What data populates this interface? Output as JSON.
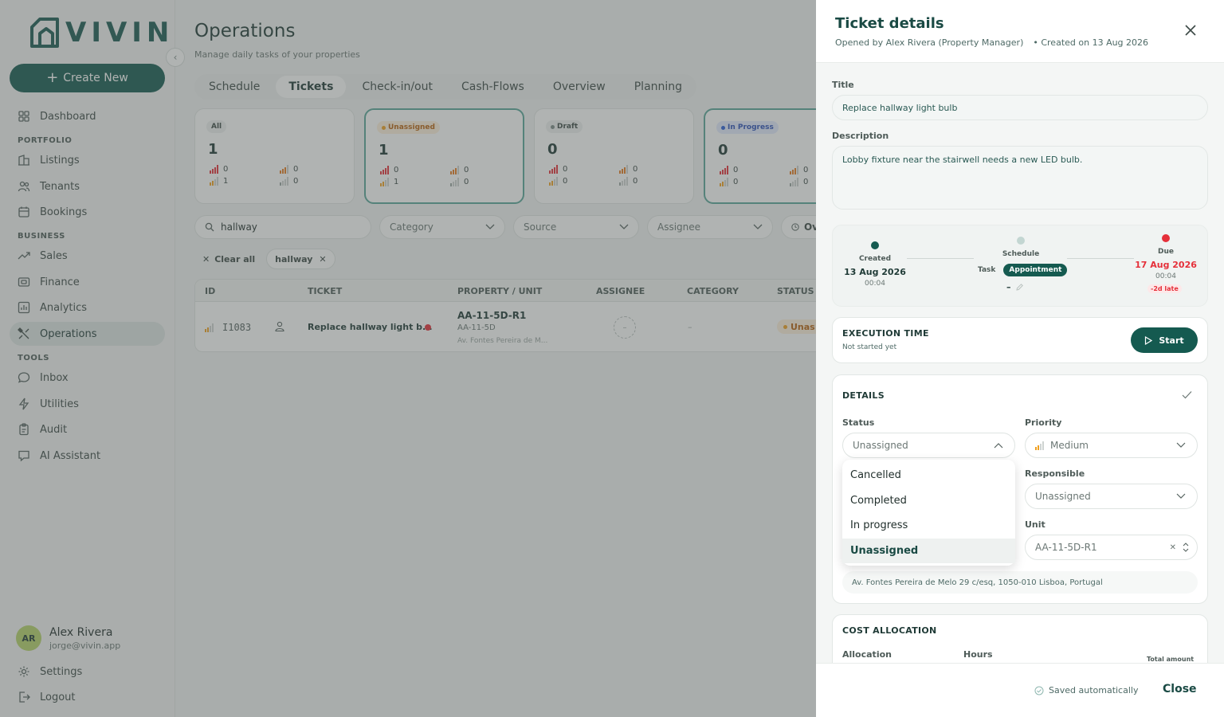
{
  "app": {
    "logo_text": "VIVIN",
    "create_new": "Create New"
  },
  "sidebar": {
    "dashboard": "Dashboard",
    "portfolio_section": "PORTFOLIO",
    "listings": "Listings",
    "tenants": "Tenants",
    "bookings": "Bookings",
    "business_section": "BUSINESS",
    "sales": "Sales",
    "finance": "Finance",
    "analytics": "Analytics",
    "operations": "Operations",
    "tools_section": "TOOLS",
    "inbox": "Inbox",
    "utilities": "Utilities",
    "audit": "Audit",
    "ai_assistant": "AI Assistant",
    "settings": "Settings",
    "logout": "Logout"
  },
  "user": {
    "initials": "AR",
    "name": "Alex Rivera",
    "email": "jorge@vivin.app"
  },
  "page": {
    "title": "Operations",
    "subtitle": "Manage daily tasks of your properties",
    "tabs": [
      "Schedule",
      "Tickets",
      "Check-in/out",
      "Cash-Flows",
      "Overview",
      "Planning"
    ],
    "active_tab": "Tickets"
  },
  "cards": [
    {
      "label": "All",
      "count": "1",
      "stats": [
        "0",
        "0",
        "1",
        "0"
      ]
    },
    {
      "label": "Unassigned",
      "count": "1",
      "stats": [
        "0",
        "0",
        "1",
        "0"
      ]
    },
    {
      "label": "Draft",
      "count": "0",
      "stats": [
        "0",
        "0",
        "0",
        "0"
      ]
    },
    {
      "label": "In Progress",
      "count": "0",
      "stats": [
        "0",
        "0",
        "0",
        "0"
      ]
    }
  ],
  "filters": {
    "search_value": "hallway",
    "category": "Category",
    "source": "Source",
    "assignee": "Assignee",
    "overdue": "Ov",
    "clear_all": "Clear all",
    "chip": "hallway"
  },
  "table": {
    "headers": [
      "ID",
      "TICKET",
      "PROPERTY / UNIT",
      "ASSIGNEE",
      "CATEGORY",
      "STATUS"
    ],
    "row": {
      "id": "I1083",
      "ticket": "Replace hallway light b...",
      "property_code": "AA-11-5D-R1",
      "unit": "AA-11-5D",
      "address": "Av. Fontes Pereira de M...",
      "assignee": "–",
      "category": "–",
      "status": "Unas"
    }
  },
  "panel": {
    "title": "Ticket details",
    "opened_by": "Opened by Alex Rivera (Property Manager)",
    "created_on": "• Created on 13 Aug 2026",
    "title_label": "Title",
    "title_value": "Replace hallway light bulb",
    "description_label": "Description",
    "description_value": "Lobby fixture near the stairwell needs a new LED bulb.",
    "timeline": {
      "created_label": "Created",
      "created_date": "13 Aug 2026",
      "created_time": "00:04",
      "schedule_label": "Schedule",
      "task": "Task",
      "appointment": "Appointment",
      "schedule_value": "–",
      "due_label": "Due",
      "due_date": "17 Aug 2026",
      "due_time": "00:04",
      "late": "-2d late"
    },
    "execution": {
      "title": "EXECUTION TIME",
      "status": "Not started yet",
      "start": "Start"
    },
    "details": {
      "title": "DETAILS",
      "status_label": "Status",
      "status_value": "Unassigned",
      "priority_label": "Priority",
      "priority_value": "Medium",
      "responsible_label": "Responsible",
      "responsible_value": "Unassigned",
      "unit_label": "Unit",
      "unit_value": "AA-11-5D-R1",
      "address": "Av. Fontes Pereira de Melo 29 c/esq, 1050-010 Lisboa, Portugal"
    },
    "status_options": [
      "Cancelled",
      "Completed",
      "In progress",
      "Unassigned"
    ],
    "selected_status": "Unassigned",
    "cost": {
      "title": "COST ALLOCATION",
      "allocation": "Allocation",
      "hours": "Hours",
      "total": "Total amount"
    },
    "saved": "Saved automatically",
    "close": "Close"
  },
  "colors": {
    "brand": "#155a50",
    "accent": "#5aa69a",
    "danger": "#e5303a",
    "warning": "#f0a020"
  }
}
